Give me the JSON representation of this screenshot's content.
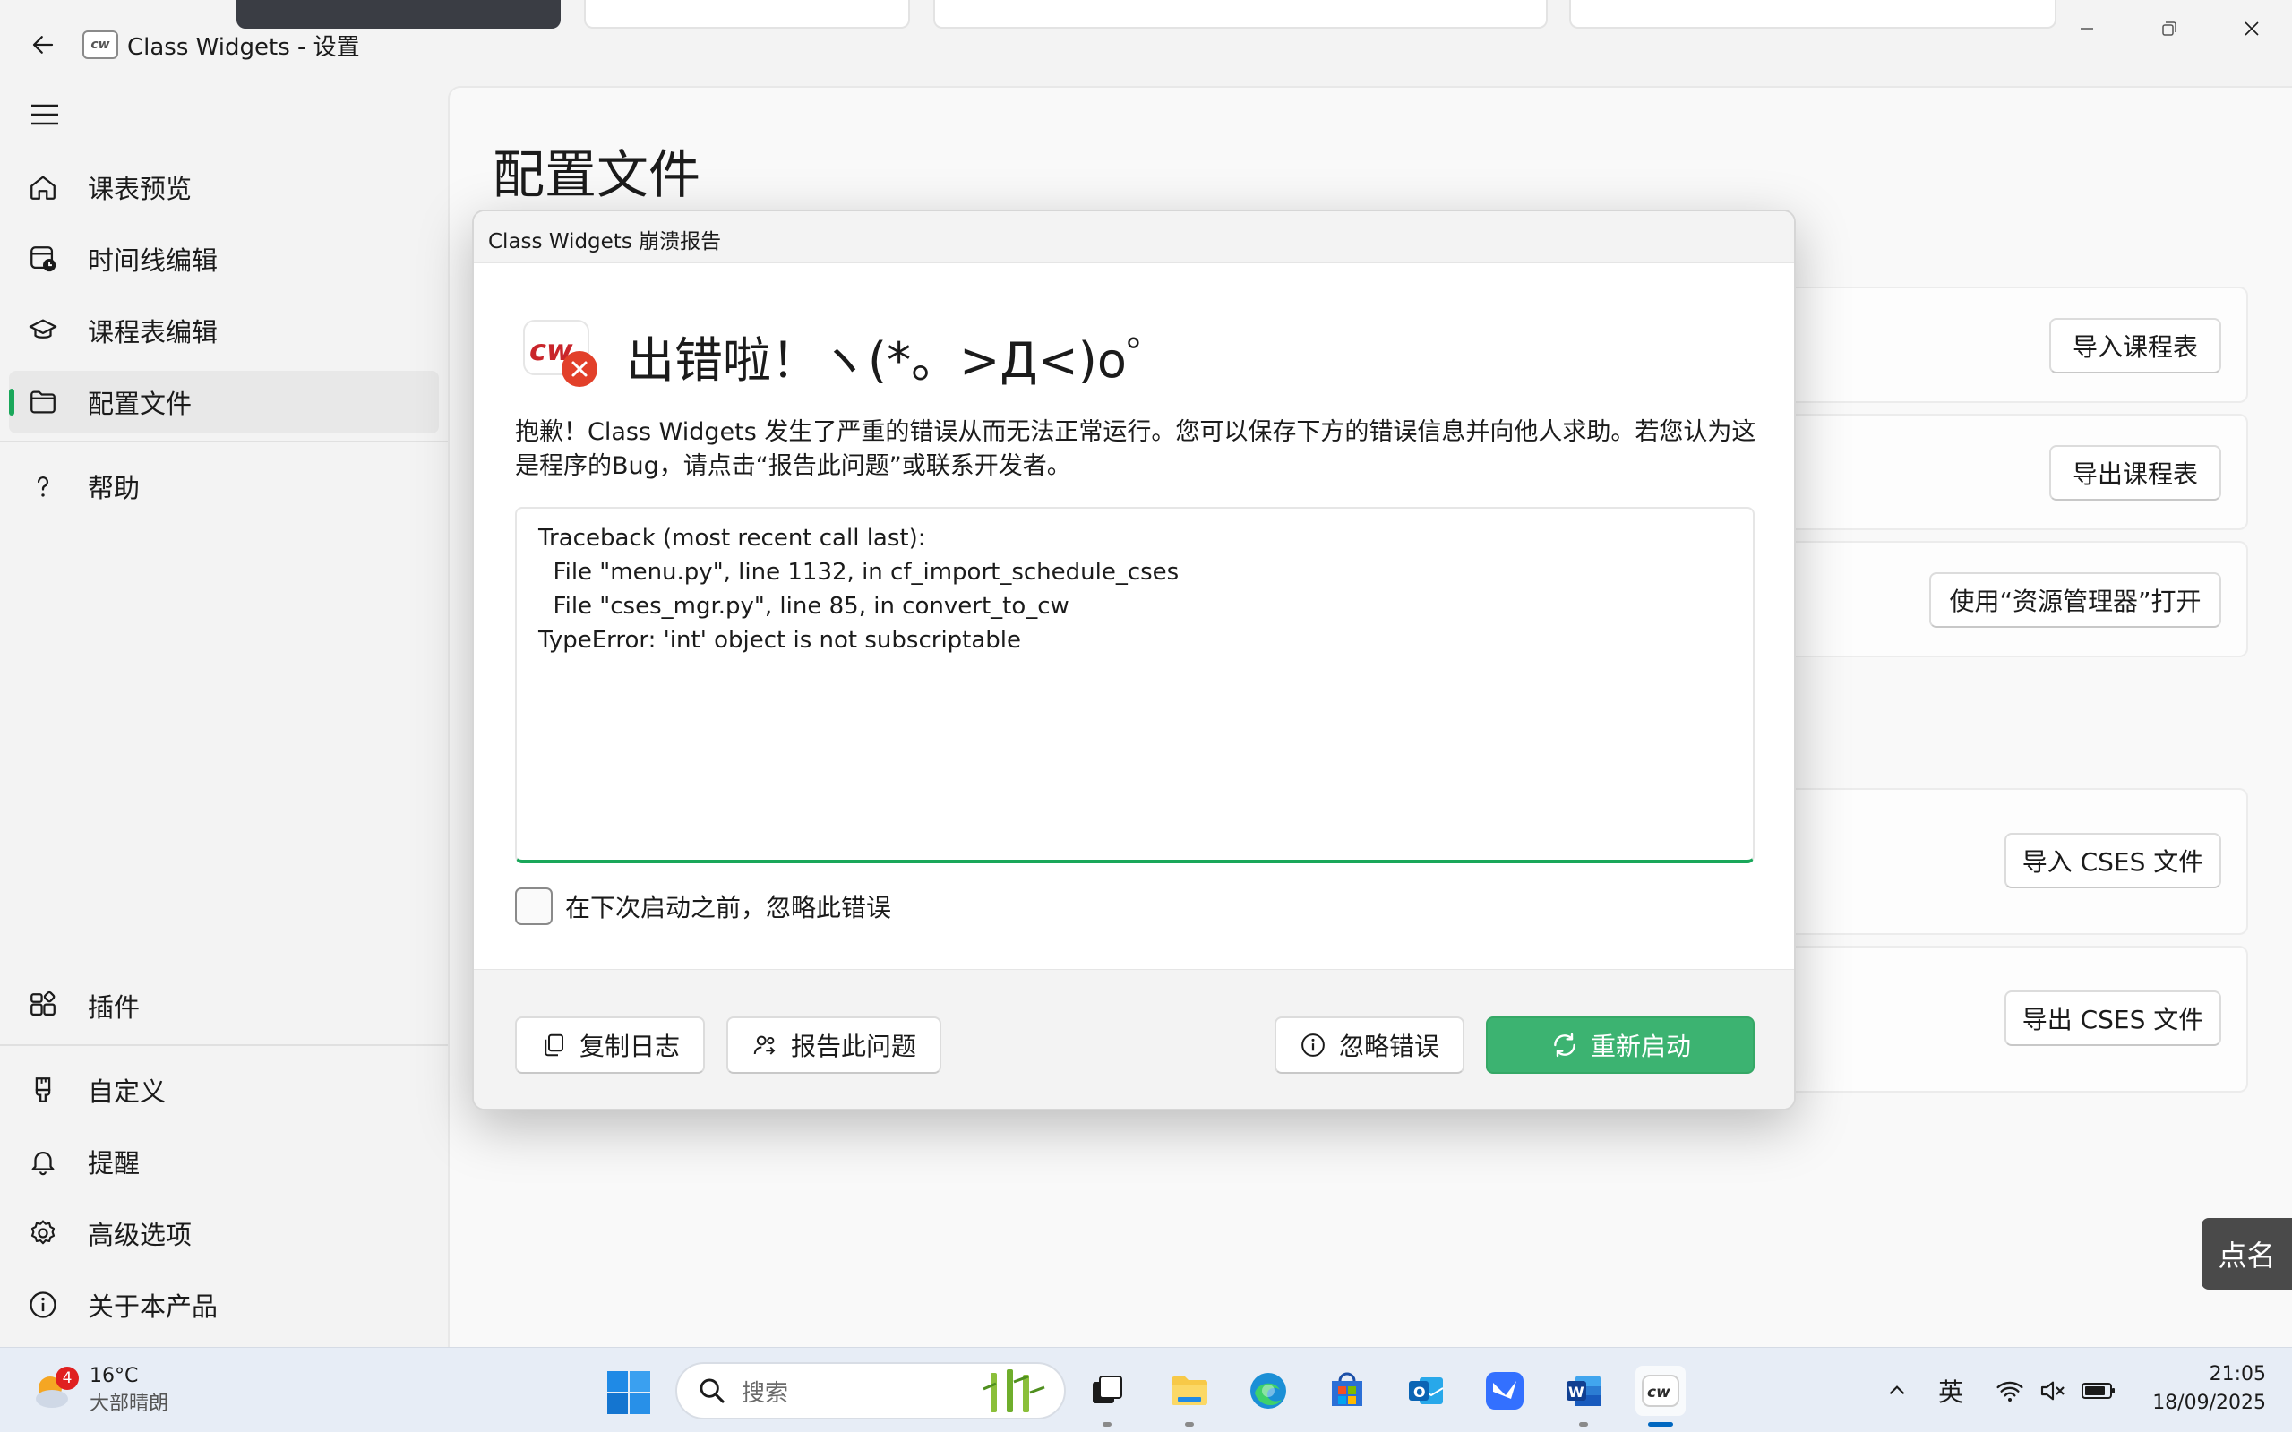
{
  "window": {
    "title": "Class Widgets - 设置",
    "logo_text": "cw"
  },
  "sidebar": {
    "items": [
      {
        "label": "课表预览",
        "icon": "home-icon"
      },
      {
        "label": "时间线编辑",
        "icon": "calendar-clock-icon"
      },
      {
        "label": "课程表编辑",
        "icon": "education-icon"
      },
      {
        "label": "配置文件",
        "icon": "folder-icon"
      },
      {
        "label": "帮助",
        "icon": "question-icon"
      }
    ],
    "bottom_items": [
      {
        "label": "插件",
        "icon": "plugin-icon"
      },
      {
        "label": "自定义",
        "icon": "brush-icon"
      },
      {
        "label": "提醒",
        "icon": "bell-icon"
      },
      {
        "label": "高级选项",
        "icon": "gear-icon"
      },
      {
        "label": "关于本产品",
        "icon": "info-icon"
      }
    ],
    "active_index": 3
  },
  "main": {
    "page_title": "配置文件",
    "buttons": {
      "import_schedule": "导入课程表",
      "export_schedule": "导出课程表",
      "open_explorer": "使用“资源管理器”打开",
      "import_cses": "导入 CSES 文件",
      "export_cses": "导出 CSES 文件"
    },
    "rollcall": "点名"
  },
  "dialog": {
    "title": "Class Widgets 崩溃报告",
    "heading": "出错啦！ヽ(*。>Д<)o゜",
    "description": "抱歉！Class Widgets 发生了严重的错误从而无法正常运行。您可以保存下方的错误信息并向他人求助。若您认为这是程序的Bug，请点击“报告此问题”或联系开发者。",
    "traceback": "Traceback (most recent call last):\n  File \"menu.py\", line 1132, in cf_import_schedule_cses\n  File \"cses_mgr.py\", line 85, in convert_to_cw\nTypeError: 'int' object is not subscriptable",
    "ignore_checkbox_label": "在下次启动之前，忽略此错误",
    "ignore_checked": false,
    "buttons": {
      "copy_log": "复制日志",
      "report": "报告此问题",
      "ignore": "忽略错误",
      "restart": "重新启动"
    },
    "accent_color": "#3cb371"
  },
  "taskbar": {
    "weather_temp": "16°C",
    "weather_desc": "大部晴朗",
    "weather_badge": "4",
    "search_placeholder": "搜索",
    "apps": [
      "task-view-icon",
      "file-explorer-icon",
      "edge-icon",
      "store-icon",
      "outlook-icon",
      "feishu-icon",
      "word-icon",
      "class-widgets-icon"
    ],
    "ime": "英",
    "time": "21:05",
    "date": "18/09/2025"
  }
}
